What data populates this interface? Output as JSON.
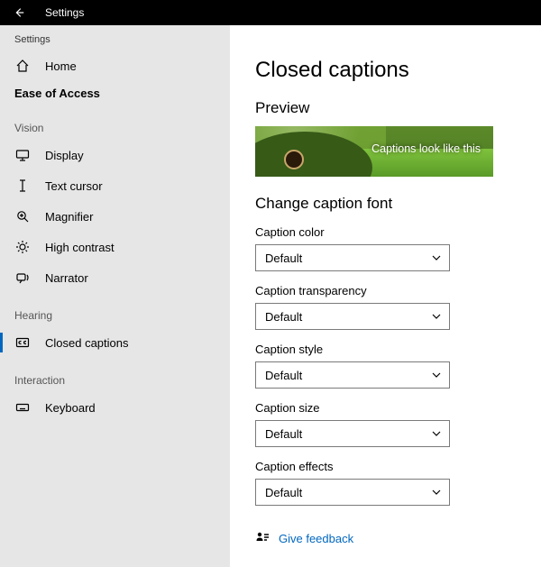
{
  "titlebar": {
    "title": "Settings"
  },
  "sidebar": {
    "crumb": "Settings",
    "home": "Home",
    "category": "Ease of Access",
    "groups": {
      "vision": {
        "label": "Vision",
        "items": [
          {
            "key": "display",
            "label": "Display"
          },
          {
            "key": "text-cursor",
            "label": "Text cursor"
          },
          {
            "key": "magnifier",
            "label": "Magnifier"
          },
          {
            "key": "high-contrast",
            "label": "High contrast"
          },
          {
            "key": "narrator",
            "label": "Narrator"
          }
        ]
      },
      "hearing": {
        "label": "Hearing",
        "items": [
          {
            "key": "closed-captions",
            "label": "Closed captions"
          }
        ]
      },
      "interaction": {
        "label": "Interaction",
        "items": [
          {
            "key": "keyboard",
            "label": "Keyboard"
          }
        ]
      }
    }
  },
  "page": {
    "title": "Closed captions",
    "preview_heading": "Preview",
    "preview_caption": "Captions look like this",
    "font_heading": "Change caption font",
    "fields": {
      "color": {
        "label": "Caption color",
        "value": "Default"
      },
      "transparency": {
        "label": "Caption transparency",
        "value": "Default"
      },
      "style": {
        "label": "Caption style",
        "value": "Default"
      },
      "size": {
        "label": "Caption size",
        "value": "Default"
      },
      "effects": {
        "label": "Caption effects",
        "value": "Default"
      }
    },
    "feedback": "Give feedback"
  }
}
